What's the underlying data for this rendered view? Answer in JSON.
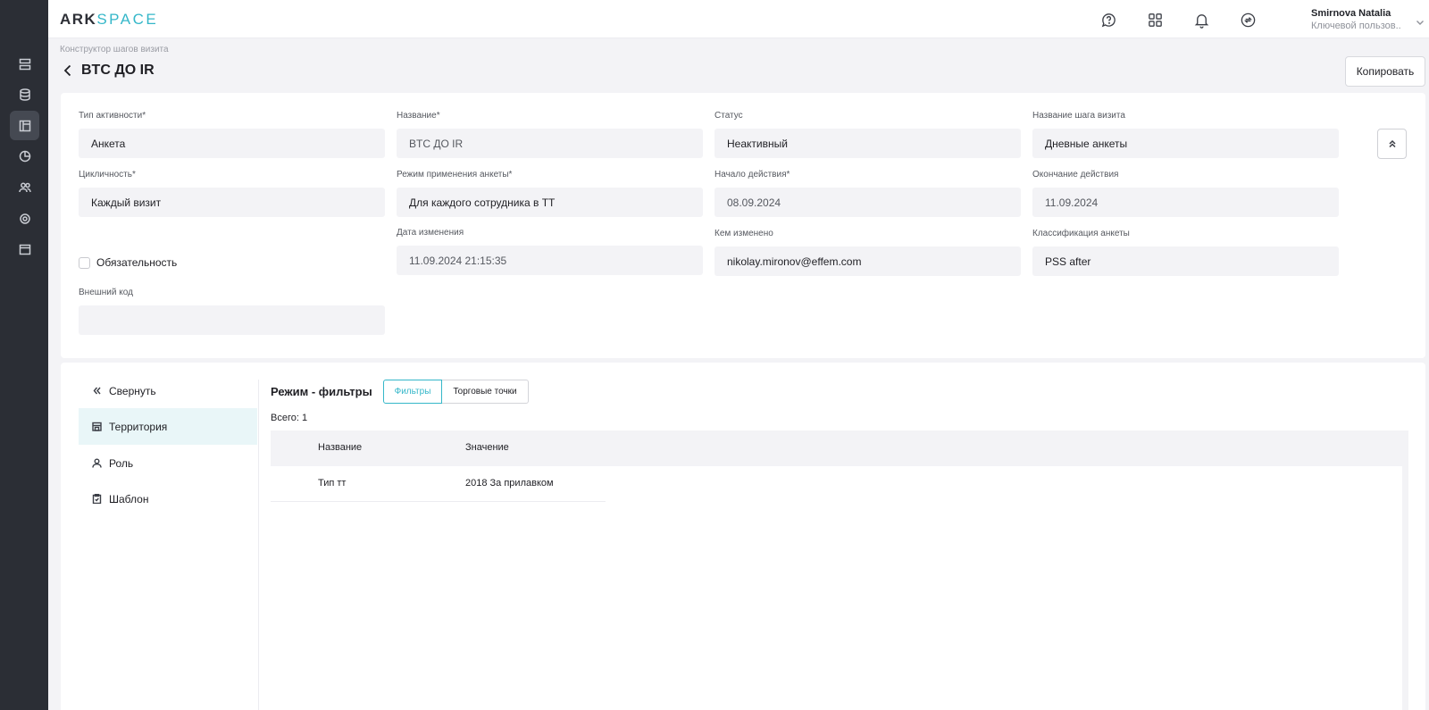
{
  "header": {
    "logo_ark": "ARK",
    "logo_space": "SPACE",
    "user_name": "Smirnova Natalia",
    "user_role": "Ключевой пользов..."
  },
  "rail": {
    "icons": [
      "list-icon",
      "database-icon",
      "layout-icon",
      "chart-icon",
      "users-icon",
      "gear-icon",
      "calendar-icon"
    ],
    "active_index": 2
  },
  "page": {
    "breadcrumb": "Конструктор шагов визита",
    "title": "BTC ДО IR",
    "copy_label": "Копировать"
  },
  "form": {
    "activity_type": {
      "label": "Тип активности*",
      "value": "Анкета"
    },
    "name": {
      "label": "Название*",
      "value": "BTC ДО IR"
    },
    "status": {
      "label": "Статус",
      "value": "Неактивный"
    },
    "step_name": {
      "label": "Название шага визита",
      "value": "Дневные анкеты"
    },
    "cyclicity": {
      "label": "Цикличность*",
      "value": "Каждый визит"
    },
    "apply_mode": {
      "label": "Режим применения анкеты*",
      "value": "Для каждого сотрудника в ТТ"
    },
    "start_date": {
      "label": "Начало действия*",
      "value": "08.09.2024"
    },
    "end_date": {
      "label": "Окончание действия",
      "value": "11.09.2024"
    },
    "mandatory": {
      "label": "Обязательность",
      "checked": false
    },
    "modified_date": {
      "label": "Дата изменения",
      "value": "11.09.2024 21:15:35"
    },
    "modified_by": {
      "label": "Кем изменено",
      "value": "nikolay.mironov@effem.com"
    },
    "classification": {
      "label": "Классификация анкеты",
      "value": "PSS after"
    },
    "external_code": {
      "label": "Внешний код",
      "value": ""
    }
  },
  "side_nav": {
    "collapse": "Свернуть",
    "territory": "Территория",
    "role": "Роль",
    "template": "Шаблон"
  },
  "filters": {
    "title": "Режим - фильтры",
    "tab_filters": "Фильтры",
    "tab_outlets": "Торговые точки",
    "total": "Всего: 1",
    "columns": [
      "Название",
      "Значение"
    ],
    "rows": [
      {
        "name": "Тип тт",
        "value": "2018 За прилавком"
      }
    ]
  },
  "colors": {
    "accent": "#35b7c9",
    "rail_bg": "#2b2e35",
    "field_bg": "#f3f3f6"
  }
}
